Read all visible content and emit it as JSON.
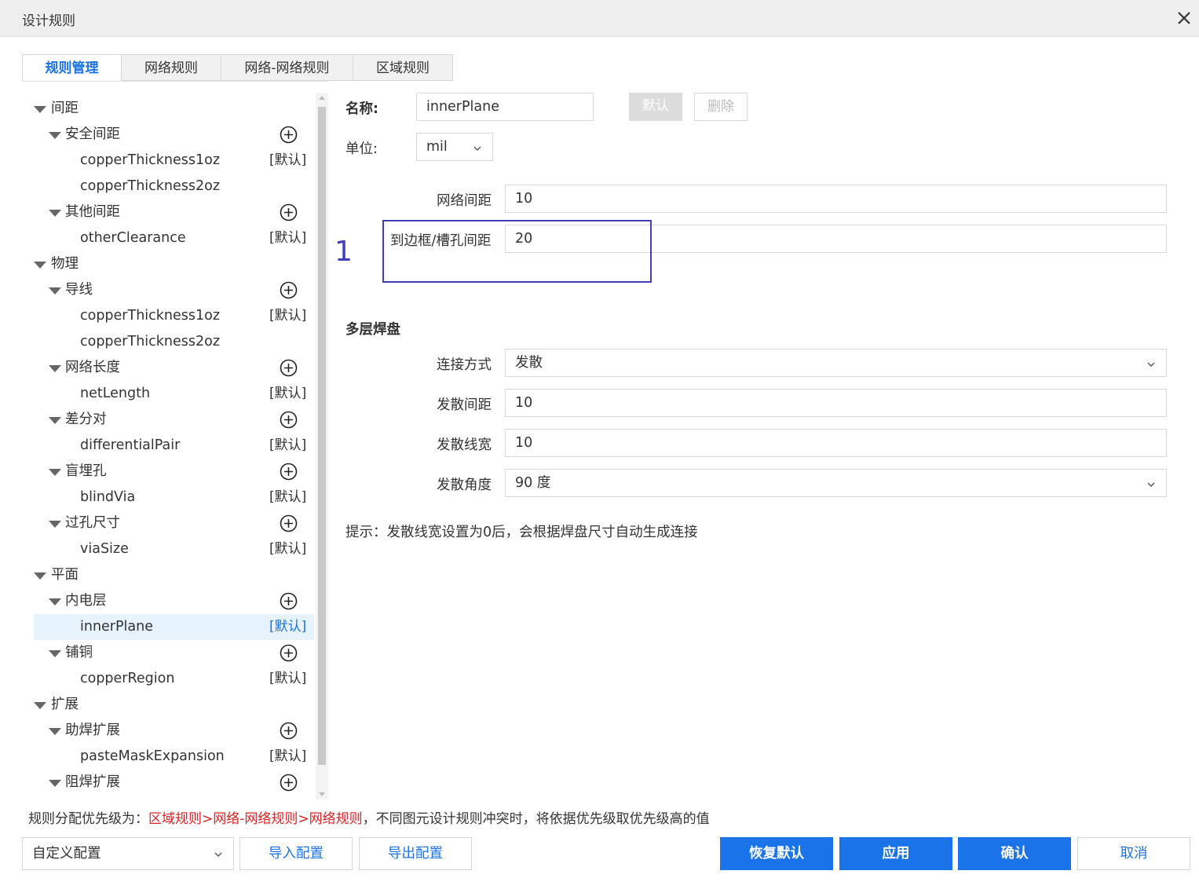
{
  "window": {
    "title": "设计规则"
  },
  "tabs": [
    {
      "label": "规则管理",
      "active": true
    },
    {
      "label": "网络规则"
    },
    {
      "label": "网络-网络规则"
    },
    {
      "label": "区域规则"
    }
  ],
  "tree": {
    "default_tag": "[默认]",
    "items": [
      {
        "label": "间距",
        "level": 0
      },
      {
        "label": "安全间距",
        "level": 1
      },
      {
        "label": "copperThickness1oz",
        "level": 2,
        "default": true
      },
      {
        "label": "copperThickness2oz",
        "level": 2
      },
      {
        "label": "其他间距",
        "level": 1
      },
      {
        "label": "otherClearance",
        "level": 2,
        "default": true
      },
      {
        "label": "物理",
        "level": 0
      },
      {
        "label": "导线",
        "level": 1
      },
      {
        "label": "copperThickness1oz",
        "level": 2,
        "default": true
      },
      {
        "label": "copperThickness2oz",
        "level": 2
      },
      {
        "label": "网络长度",
        "level": 1
      },
      {
        "label": "netLength",
        "level": 2,
        "default": true
      },
      {
        "label": "差分对",
        "level": 1
      },
      {
        "label": "differentialPair",
        "level": 2,
        "default": true
      },
      {
        "label": "盲埋孔",
        "level": 1
      },
      {
        "label": "blindVia",
        "level": 2,
        "default": true
      },
      {
        "label": "过孔尺寸",
        "level": 1
      },
      {
        "label": "viaSize",
        "level": 2,
        "default": true
      },
      {
        "label": "平面",
        "level": 0
      },
      {
        "label": "内电层",
        "level": 1
      },
      {
        "label": "innerPlane",
        "level": 2,
        "default": true,
        "selected": true
      },
      {
        "label": "铺铜",
        "level": 1
      },
      {
        "label": "copperRegion",
        "level": 2,
        "default": true
      },
      {
        "label": "扩展",
        "level": 0
      },
      {
        "label": "助焊扩展",
        "level": 1
      },
      {
        "label": "pasteMaskExpansion",
        "level": 2,
        "default": true
      },
      {
        "label": "阻焊扩展",
        "level": 1
      }
    ]
  },
  "form": {
    "name_label": "名称:",
    "name_value": "innerPlane",
    "default_button": "默认",
    "delete_button": "删除",
    "unit_label": "单位:",
    "unit_value": "mil",
    "net_clearance_label": "网络间距",
    "net_clearance_value": "10",
    "board_clearance_label": "到边框/槽孔间距",
    "board_clearance_value": "20",
    "annotation": "1",
    "multilayer_pad_title": "多层焊盘",
    "connect_label": "连接方式",
    "connect_value": "发散",
    "spoke_gap_label": "发散间距",
    "spoke_gap_value": "10",
    "spoke_width_label": "发散线宽",
    "spoke_width_value": "10",
    "spoke_angle_label": "发散角度",
    "spoke_angle_value": "90 度",
    "hint": "提示：发散线宽设置为0后，会根据焊盘尺寸自动生成连接"
  },
  "footer": {
    "note_prefix": "规则分配优先级为：",
    "note_priority": "区域规则>网络-网络规则>网络规则",
    "note_suffix": "，不同图元设计规则冲突时，将依据优先级取优先级高的值",
    "config_select": "自定义配置",
    "import_button": "导入配置",
    "export_button": "导出配置",
    "restore_button": "恢复默认",
    "apply_button": "应用",
    "confirm_button": "确认",
    "cancel_button": "取消"
  },
  "colors": {
    "accent": "#1a73e8",
    "warning_text": "#e02020",
    "annotation": "#3f3fb8"
  }
}
